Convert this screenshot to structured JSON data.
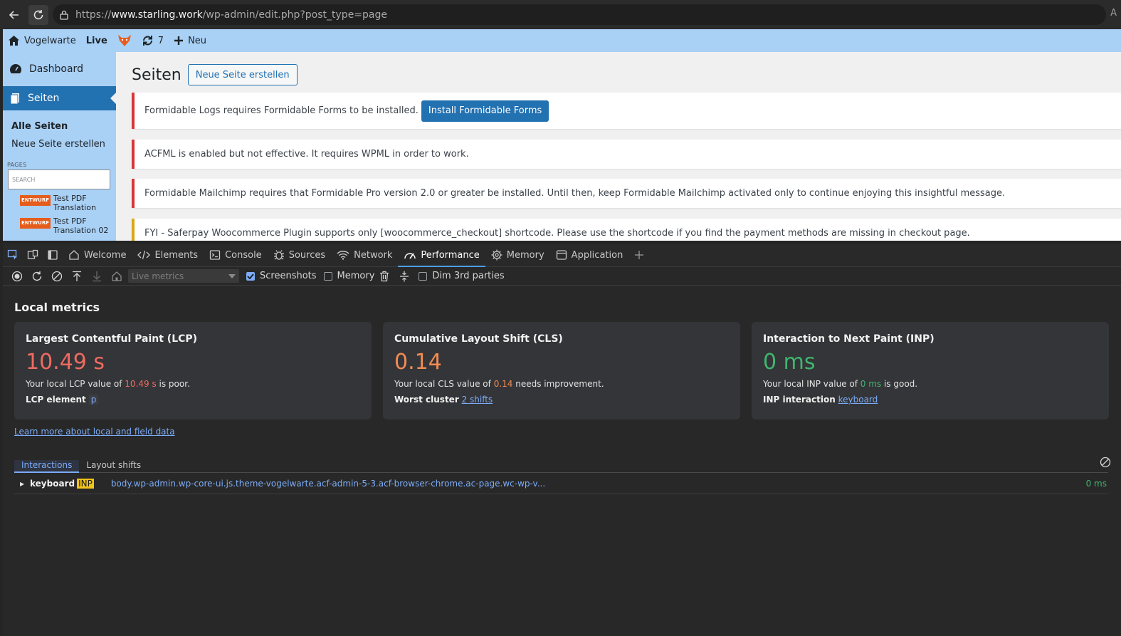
{
  "browser": {
    "url_prefix": "https://",
    "url_host": "www.starling.work",
    "url_path": "/wp-admin/edit.php?post_type=page",
    "read_aloud": "A"
  },
  "adminbar": {
    "site_name": "Vogelwarte",
    "live_label": "Live",
    "updates_count": "7",
    "new_label": "Neu"
  },
  "sidebar": {
    "dashboard": "Dashboard",
    "pages": "Seiten",
    "sub_all": "Alle Seiten",
    "sub_new": "Neue Seite erstellen",
    "pages_label": "PAGES",
    "search_placeholder": "SEARCH",
    "tree": [
      {
        "badge": "ENTWURF",
        "title": "Test PDF Translation"
      },
      {
        "badge": "ENTWURF",
        "title": "Test PDF Translation 02"
      }
    ]
  },
  "content": {
    "title": "Seiten",
    "new_button": "Neue Seite erstellen",
    "notices": [
      {
        "text": "Formidable Logs requires Formidable Forms to be installed.",
        "button": "Install Formidable Forms"
      },
      {
        "text": "ACFML is enabled but not effective. It requires WPML in order to work."
      },
      {
        "text": "Formidable Mailchimp requires that Formidable Pro version 2.0 or greater be installed. Until then, keep Formidable Mailchimp activated only to continue enjoying this insightful message."
      },
      {
        "text": "FYI - Saferpay Woocommerce Plugin supports only [woocommerce_checkout] shortcode. Please use the shortcode if you find the payment methods are missing in checkout page."
      }
    ]
  },
  "devtools": {
    "tabs": [
      "Welcome",
      "Elements",
      "Console",
      "Sources",
      "Network",
      "Performance",
      "Memory",
      "Application"
    ],
    "active_tab": "Performance",
    "toolbar": {
      "live_metrics": "Live metrics",
      "screenshots": "Screenshots",
      "memory": "Memory",
      "dim_3rd": "Dim 3rd parties"
    },
    "local_metrics_title": "Local metrics",
    "cards": {
      "lcp": {
        "title": "Largest Contentful Paint (LCP)",
        "value": "10.49 s",
        "desc_pre": "Your local LCP value of ",
        "desc_val": "10.49 s",
        "desc_post": " is poor.",
        "extra_label": "LCP element",
        "extra_value": "p"
      },
      "cls": {
        "title": "Cumulative Layout Shift (CLS)",
        "value": "0.14",
        "desc_pre": "Your local CLS value of ",
        "desc_val": "0.14",
        "desc_post": " needs improvement.",
        "extra_label": "Worst cluster",
        "extra_value": "2 shifts"
      },
      "inp": {
        "title": "Interaction to Next Paint (INP)",
        "value": "0 ms",
        "desc_pre": "Your local INP value of ",
        "desc_val": "0 ms",
        "desc_post": " is good.",
        "extra_label": "INP interaction",
        "extra_value": "keyboard"
      }
    },
    "learn_more": "Learn more about local and field data",
    "sub_tabs": [
      "Interactions",
      "Layout shifts"
    ],
    "interaction": {
      "type": "keyboard",
      "tag": "INP",
      "target": "body.wp-admin.wp-core-ui.js.theme-vogelwarte.acf-admin-5-3.acf-browser-chrome.ac-page.wc-wp-v...",
      "duration": "0 ms"
    }
  },
  "colors": {
    "wp_adminbar": "#a9d0f5",
    "wp_blue": "#2271b1",
    "notice_error": "#d63638",
    "notice_warning": "#dba617",
    "metric_poor": "#ee6b61",
    "metric_needs_improvement": "#f28b54",
    "metric_good": "#3fb66d",
    "devtools_accent": "#7cacf8"
  }
}
